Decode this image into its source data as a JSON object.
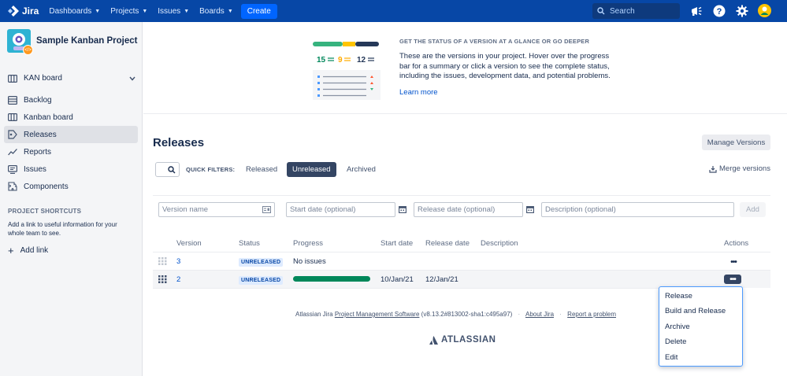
{
  "topnav": {
    "logo_label": "Jira",
    "menu": [
      {
        "label": "Dashboards"
      },
      {
        "label": "Projects"
      },
      {
        "label": "Issues"
      },
      {
        "label": "Boards"
      }
    ],
    "create_label": "Create",
    "search_placeholder": "Search"
  },
  "sidebar": {
    "project_name": "Sample Kanban Project",
    "board_selector": "KAN board",
    "items": [
      {
        "label": "Backlog",
        "icon": "backlog-icon"
      },
      {
        "label": "Kanban board",
        "icon": "board-icon"
      },
      {
        "label": "Releases",
        "icon": "releases-icon",
        "active": true
      },
      {
        "label": "Reports",
        "icon": "reports-icon"
      },
      {
        "label": "Issues",
        "icon": "issues-icon"
      },
      {
        "label": "Components",
        "icon": "components-icon"
      }
    ],
    "shortcuts_title": "PROJECT SHORTCUTS",
    "shortcuts_desc": "Add a link to useful information for your whole team to see.",
    "add_link": "Add link"
  },
  "banner": {
    "illustration_counts": [
      "15",
      "9",
      "12"
    ],
    "title": "GET THE STATUS OF A VERSION AT A GLANCE OR GO DEEPER",
    "text": "These are the versions in your project. Hover over the progress bar for a summary or click a version to see the complete status, including the issues, development data, and potential problems.",
    "learn_more": "Learn more"
  },
  "page": {
    "title": "Releases",
    "manage_versions": "Manage Versions",
    "quick_filters_label": "QUICK FILTERS:",
    "filters": [
      {
        "label": "Released",
        "active": false
      },
      {
        "label": "Unreleased",
        "active": true
      },
      {
        "label": "Archived",
        "active": false
      }
    ],
    "merge_versions": "Merge versions"
  },
  "add_form": {
    "version_name_placeholder": "Version name",
    "start_date_placeholder": "Start date (optional)",
    "release_date_placeholder": "Release date (optional)",
    "description_placeholder": "Description (optional)",
    "add_label": "Add"
  },
  "table": {
    "headers": {
      "version": "Version",
      "status": "Status",
      "progress": "Progress",
      "start_date": "Start date",
      "release_date": "Release date",
      "description": "Description",
      "actions": "Actions"
    },
    "rows": [
      {
        "version": "3",
        "status": "UNRELEASED",
        "progress_text": "No issues",
        "start_date": "",
        "release_date": "",
        "description": ""
      },
      {
        "version": "2",
        "status": "UNRELEASED",
        "progress_fraction": 1.0,
        "start_date": "10/Jan/21",
        "release_date": "12/Jan/21",
        "description": ""
      }
    ],
    "more_label": "•••"
  },
  "actions_menu": [
    "Release",
    "Build and Release",
    "Archive",
    "Delete",
    "Edit"
  ],
  "footer": {
    "prefix": "Atlassian Jira",
    "product_link": "Project Management Software",
    "version": "(v8.13.2#813002-sha1:c495a97)",
    "about": "About Jira",
    "report": "Report a problem",
    "brand": "ATLASSIAN"
  },
  "colors": {
    "nav": "#0747a6",
    "create": "#0065ff",
    "link": "#0052cc",
    "progress_done": "#00875a",
    "active_filter": "#344563"
  }
}
